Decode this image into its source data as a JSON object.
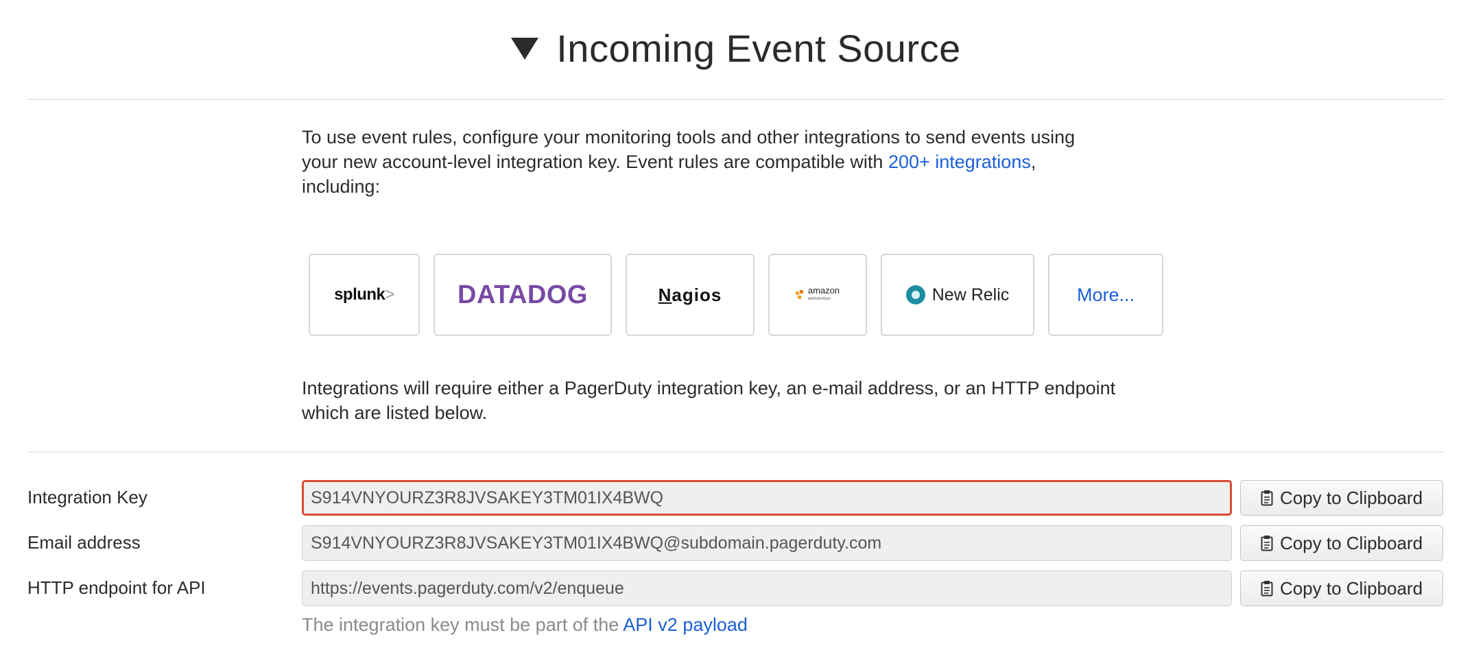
{
  "header": {
    "title": "Incoming Event Source",
    "toggle_icon": "triangle-down-icon"
  },
  "intro": {
    "line1": "To use event rules, configure your monitoring tools and other integrations to send events using",
    "line2_before": "your new account-level integration key. Event rules are compatible with ",
    "line2_link": "200+ integrations",
    "line2_after": ",",
    "line3": "including:"
  },
  "integrations": {
    "splunk": "splunk",
    "splunk_suffix": ">",
    "datadog": "DATADOG",
    "nagios_first": "N",
    "nagios_rest": "agios",
    "amazon": "amazon",
    "amazon_sub": "webservices",
    "newrelic": "New Relic",
    "more": "More..."
  },
  "requirements": {
    "line1": "Integrations will require either a PagerDuty integration key, an e-mail address, or an HTTP endpoint",
    "line2": "which are listed below."
  },
  "fields": {
    "integration_key": {
      "label": "Integration Key",
      "value": "S914VNYOURZ3R8JVSAKEY3TM01IX4BWQ",
      "button": "Copy to Clipboard"
    },
    "email": {
      "label": "Email address",
      "value": "S914VNYOURZ3R8JVSAKEY3TM01IX4BWQ@subdomain.pagerduty.com",
      "button": "Copy to Clipboard"
    },
    "http": {
      "label": "HTTP endpoint for API",
      "value": "https://events.pagerduty.com/v2/enqueue",
      "button": "Copy to Clipboard"
    }
  },
  "note": {
    "text": "The integration key must be part of the ",
    "link": "API v2 payload"
  },
  "colors": {
    "link": "#1a5fd6",
    "focus_border": "#d84a2e",
    "datadog": "#774aa4",
    "newrelic": "#1c8da0"
  }
}
